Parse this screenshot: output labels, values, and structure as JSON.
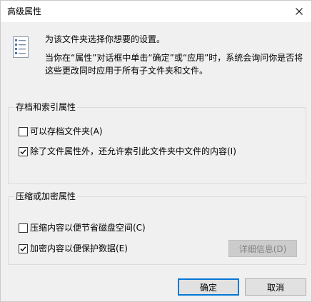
{
  "window": {
    "title": "高级属性",
    "close_icon": "close-icon"
  },
  "description": {
    "icon": "properties-list-icon",
    "line1": "为该文件夹选择你想要的设置。",
    "line2": "当你在“属性”对话框中单击“确定”或“应用”时，系统会询问你是否将这些更改同时应用于所有子文件夹和文件。"
  },
  "archive_group": {
    "title": "存档和索引属性",
    "options": [
      {
        "label": "可以存档文件夹(A)",
        "checked": false
      },
      {
        "label": "除了文件属性外，还允许索引此文件夹中文件的内容(I)",
        "checked": true
      }
    ]
  },
  "compress_group": {
    "title": "压缩或加密属性",
    "options": [
      {
        "label": "压缩内容以便节省磁盘空间(C)",
        "checked": false
      },
      {
        "label": "加密内容以便保护数据(E)",
        "checked": true
      }
    ],
    "details_label": "详细信息(D)",
    "details_enabled": false
  },
  "buttons": {
    "ok_label": "确定",
    "cancel_label": "取消"
  },
  "colors": {
    "dialog_bg": "#f0f0f0",
    "titlebar_bg": "#ffffff",
    "default_button_border": "#0078d7",
    "disabled_text": "#838383"
  }
}
